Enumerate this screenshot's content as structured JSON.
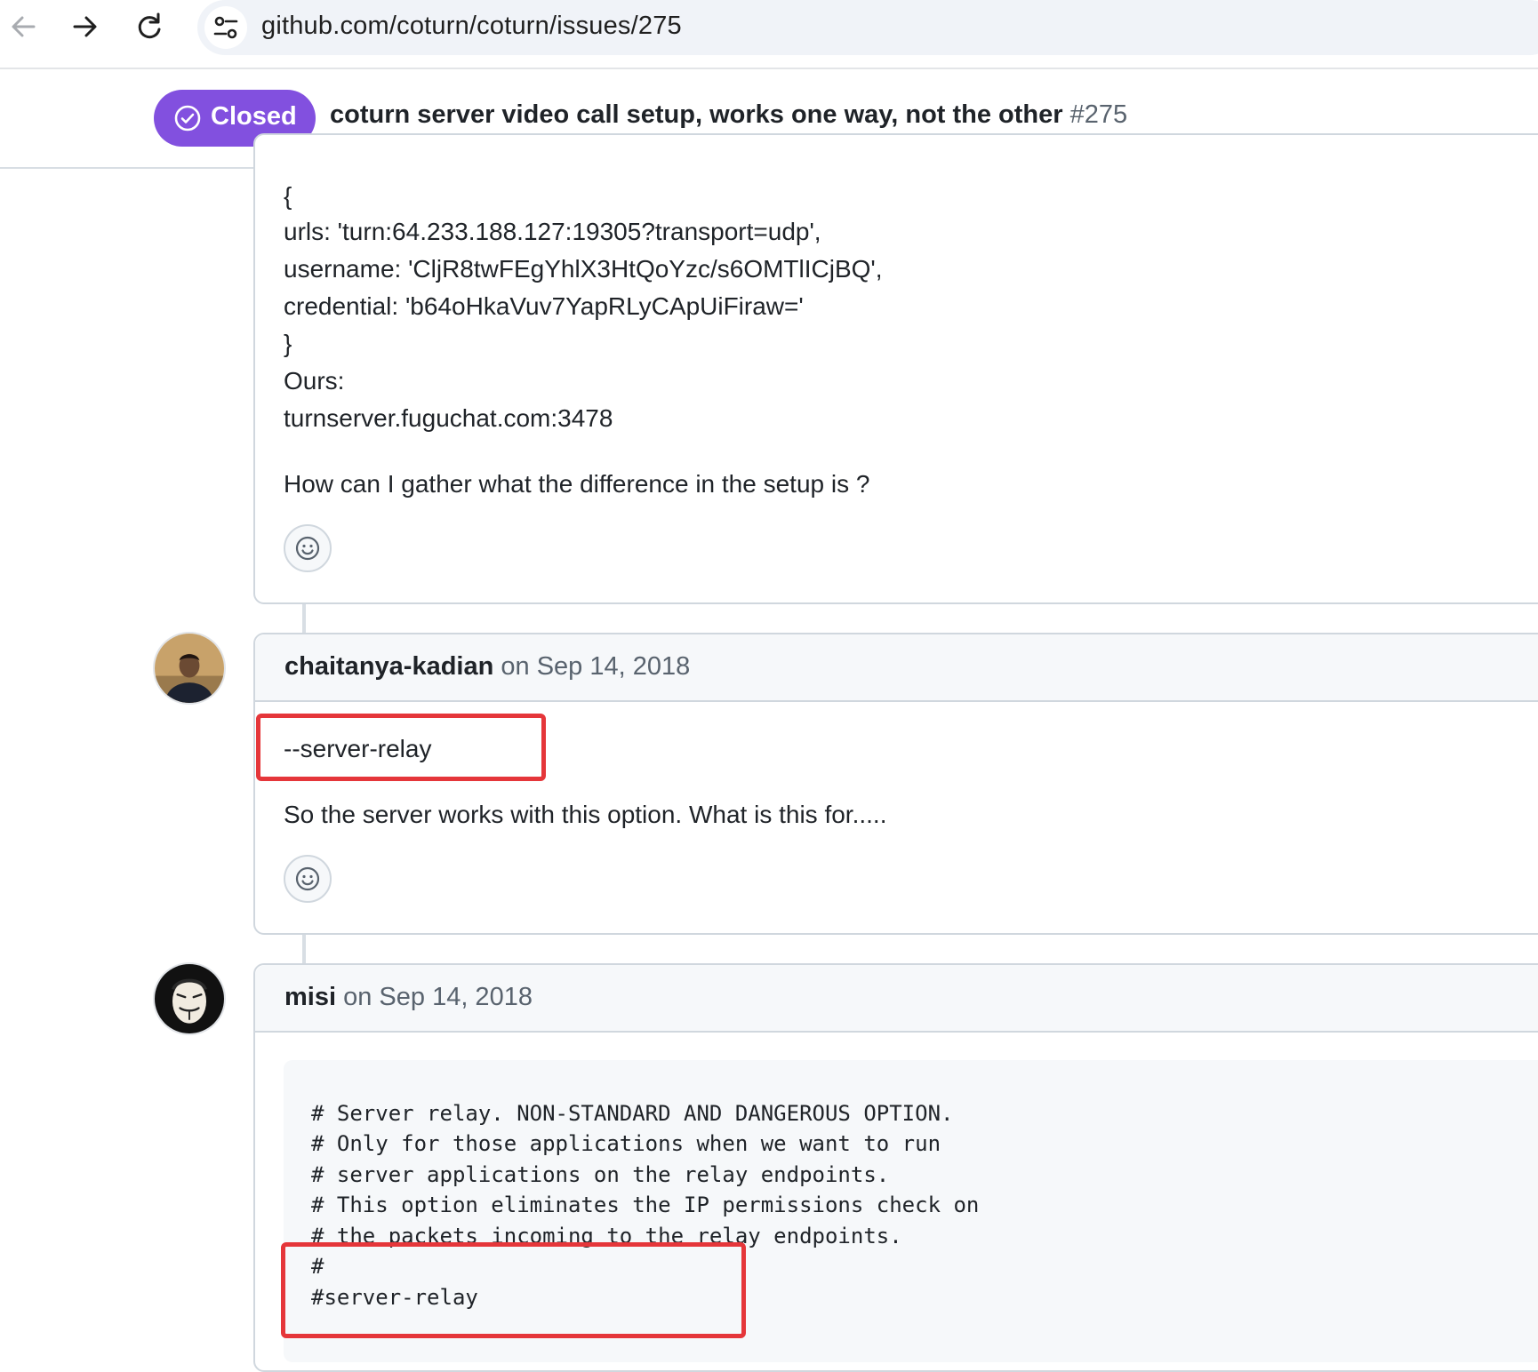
{
  "browser": {
    "url": "github.com/coturn/coturn/issues/275",
    "icons": {
      "back": "back-arrow-icon",
      "forward": "forward-arrow-icon",
      "reload": "reload-icon",
      "site_info": "site-settings-icon"
    }
  },
  "issue": {
    "state_label": "Closed",
    "state_color": "#8250df",
    "title": "coturn server video call setup, works one way, not the other",
    "number": "#275"
  },
  "first_comment": {
    "lines": [
      "{",
      "urls: 'turn:64.233.188.127:19305?transport=udp',",
      "username: 'CljR8twFEgYhlX3HtQoYzc/s6OMTlICjBQ',",
      "credential: 'b64oHkaVuv7YapRLyCApUiFiraw='",
      "}",
      "Ours:",
      "turnserver.fuguchat.com:3478"
    ],
    "question": "How can I gather what the difference in the setup is ?"
  },
  "second_comment": {
    "author": "chaitanya-kadian",
    "date": "on Sep 14, 2018",
    "option": "--server-relay",
    "text": "So the server works with this option. What is this for....."
  },
  "third_comment": {
    "author": "misi",
    "date": "on Sep 14, 2018",
    "code_lines": [
      "# Server relay. NON-STANDARD AND DANGEROUS OPTION.",
      "# Only for those applications when we want to run",
      "# server applications on the relay endpoints.",
      "# This option eliminates the IP permissions check on",
      "# the packets incoming to the relay endpoints.",
      "#",
      "#server-relay"
    ]
  },
  "highlight_color": "#e5363a"
}
